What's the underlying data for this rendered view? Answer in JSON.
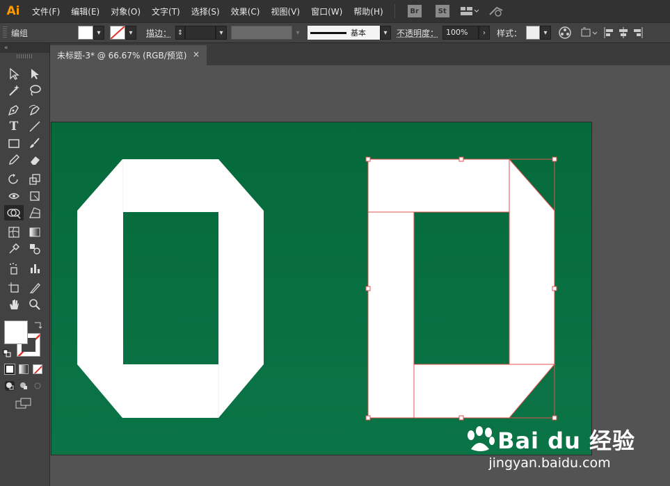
{
  "app": {
    "logo": "Ai",
    "accent": "#ff9a00"
  },
  "menu": [
    "文件(F)",
    "编辑(E)",
    "对象(O)",
    "文字(T)",
    "选择(S)",
    "效果(C)",
    "视图(V)",
    "窗口(W)",
    "帮助(H)"
  ],
  "menu_icons": {
    "bridge": "Br",
    "stock": "St"
  },
  "control": {
    "group_label": "编组",
    "stroke_label": "描边：",
    "stroke_style": "基本",
    "opacity_label": "不透明度：",
    "opacity_value": "100%",
    "style_label": "样式："
  },
  "document_tab": {
    "title": "未标题-3* @ 66.67% (RGB/预览)",
    "close": "×"
  },
  "artboard": {
    "background": "#05693b",
    "shape_color": "#ffffff",
    "selection_color": "#e0524f"
  },
  "watermark": {
    "brand": "Bai du 经验",
    "url": "jingyan.baidu.com"
  }
}
